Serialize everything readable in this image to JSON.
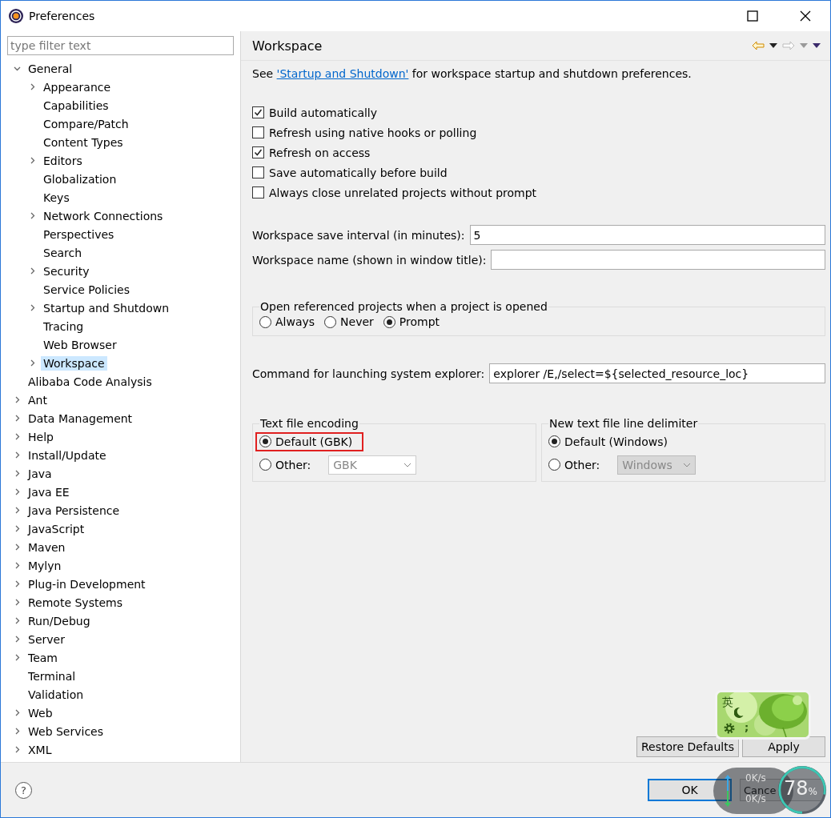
{
  "window": {
    "title": "Preferences"
  },
  "filter": {
    "placeholder": "type filter text"
  },
  "tree": [
    {
      "label": "General",
      "expandable": true,
      "expanded": true,
      "selected": false,
      "children": [
        {
          "label": "Appearance",
          "expandable": true,
          "expanded": false,
          "selected": false
        },
        {
          "label": "Capabilities",
          "expandable": false,
          "expanded": false,
          "selected": false
        },
        {
          "label": "Compare/Patch",
          "expandable": false,
          "expanded": false,
          "selected": false
        },
        {
          "label": "Content Types",
          "expandable": false,
          "expanded": false,
          "selected": false
        },
        {
          "label": "Editors",
          "expandable": true,
          "expanded": false,
          "selected": false
        },
        {
          "label": "Globalization",
          "expandable": false,
          "expanded": false,
          "selected": false
        },
        {
          "label": "Keys",
          "expandable": false,
          "expanded": false,
          "selected": false
        },
        {
          "label": "Network Connections",
          "expandable": true,
          "expanded": false,
          "selected": false
        },
        {
          "label": "Perspectives",
          "expandable": false,
          "expanded": false,
          "selected": false
        },
        {
          "label": "Search",
          "expandable": false,
          "expanded": false,
          "selected": false
        },
        {
          "label": "Security",
          "expandable": true,
          "expanded": false,
          "selected": false
        },
        {
          "label": "Service Policies",
          "expandable": false,
          "expanded": false,
          "selected": false
        },
        {
          "label": "Startup and Shutdown",
          "expandable": true,
          "expanded": false,
          "selected": false
        },
        {
          "label": "Tracing",
          "expandable": false,
          "expanded": false,
          "selected": false
        },
        {
          "label": "Web Browser",
          "expandable": false,
          "expanded": false,
          "selected": false
        },
        {
          "label": "Workspace",
          "expandable": true,
          "expanded": false,
          "selected": true
        }
      ]
    },
    {
      "label": "Alibaba Code Analysis",
      "expandable": false,
      "expanded": false,
      "selected": false
    },
    {
      "label": "Ant",
      "expandable": true,
      "expanded": false,
      "selected": false
    },
    {
      "label": "Data Management",
      "expandable": true,
      "expanded": false,
      "selected": false
    },
    {
      "label": "Help",
      "expandable": true,
      "expanded": false,
      "selected": false
    },
    {
      "label": "Install/Update",
      "expandable": true,
      "expanded": false,
      "selected": false
    },
    {
      "label": "Java",
      "expandable": true,
      "expanded": false,
      "selected": false
    },
    {
      "label": "Java EE",
      "expandable": true,
      "expanded": false,
      "selected": false
    },
    {
      "label": "Java Persistence",
      "expandable": true,
      "expanded": false,
      "selected": false
    },
    {
      "label": "JavaScript",
      "expandable": true,
      "expanded": false,
      "selected": false
    },
    {
      "label": "Maven",
      "expandable": true,
      "expanded": false,
      "selected": false
    },
    {
      "label": "Mylyn",
      "expandable": true,
      "expanded": false,
      "selected": false
    },
    {
      "label": "Plug-in Development",
      "expandable": true,
      "expanded": false,
      "selected": false
    },
    {
      "label": "Remote Systems",
      "expandable": true,
      "expanded": false,
      "selected": false
    },
    {
      "label": "Run/Debug",
      "expandable": true,
      "expanded": false,
      "selected": false
    },
    {
      "label": "Server",
      "expandable": true,
      "expanded": false,
      "selected": false
    },
    {
      "label": "Team",
      "expandable": true,
      "expanded": false,
      "selected": false
    },
    {
      "label": "Terminal",
      "expandable": false,
      "expanded": false,
      "selected": false
    },
    {
      "label": "Validation",
      "expandable": false,
      "expanded": false,
      "selected": false
    },
    {
      "label": "Web",
      "expandable": true,
      "expanded": false,
      "selected": false
    },
    {
      "label": "Web Services",
      "expandable": true,
      "expanded": false,
      "selected": false
    },
    {
      "label": "XML",
      "expandable": true,
      "expanded": false,
      "selected": false
    }
  ],
  "page": {
    "title": "Workspace",
    "intro_before": "See",
    "intro_link": "'Startup and Shutdown'",
    "intro_after": "for workspace startup and shutdown preferences.",
    "checkboxes": [
      {
        "label": "Build automatically",
        "checked": true
      },
      {
        "label": "Refresh using native hooks or polling",
        "checked": false
      },
      {
        "label": "Refresh on access",
        "checked": true
      },
      {
        "label": "Save automatically before build",
        "checked": false
      },
      {
        "label": "Always close unrelated projects without prompt",
        "checked": false
      }
    ],
    "fields": [
      {
        "label": "Workspace save interval (in minutes):",
        "value": "5"
      },
      {
        "label": "Workspace name (shown in window title):"
      }
    ],
    "open_projects": {
      "title": "Open referenced projects when a project is opened",
      "options": [
        {
          "label": "Always",
          "selected": false
        },
        {
          "label": "Never",
          "selected": false
        },
        {
          "label": "Prompt",
          "selected": true
        }
      ]
    },
    "explorer": {
      "label": "Command for launching system explorer:",
      "value": "explorer /E,/select=${selected_resource_loc}"
    },
    "groups": [
      {
        "title": "Text file encoding",
        "options": [
          {
            "label": "Default (GBK)",
            "selected": true,
            "highlighted": true
          },
          {
            "label": "Other:",
            "selected": false,
            "highlighted": false,
            "combo": {
              "value": "GBK",
              "kind": "editable"
            }
          }
        ]
      },
      {
        "title": "New text file line delimiter",
        "options": [
          {
            "label": "Default (Windows)",
            "selected": true,
            "highlighted": false
          },
          {
            "label": "Other:",
            "selected": false,
            "highlighted": false,
            "combo": {
              "value": "Windows",
              "kind": "readonly"
            }
          }
        ]
      }
    ],
    "buttons": [
      "Restore Defaults",
      "Apply"
    ]
  },
  "footer": {
    "help": "?",
    "buttons": [
      {
        "label": "OK",
        "default": true
      },
      {
        "label": "Cance",
        "default": false
      }
    ]
  },
  "ime_widget": {
    "mode": "英",
    "punct": ";"
  },
  "net_widget": {
    "up": "0K/s",
    "down": "0K/s",
    "percent": "78",
    "unit": "%"
  }
}
